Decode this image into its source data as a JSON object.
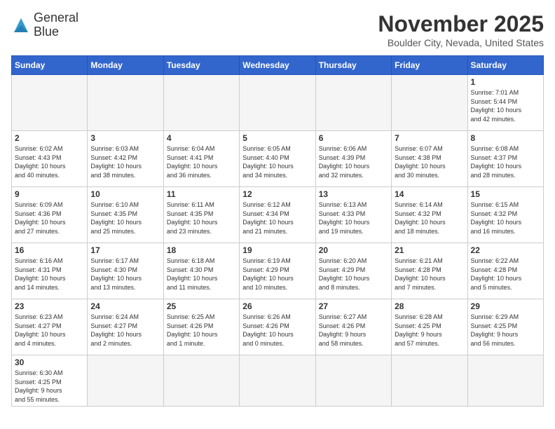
{
  "header": {
    "logo_line1": "General",
    "logo_line2": "Blue",
    "month": "November 2025",
    "location": "Boulder City, Nevada, United States"
  },
  "weekdays": [
    "Sunday",
    "Monday",
    "Tuesday",
    "Wednesday",
    "Thursday",
    "Friday",
    "Saturday"
  ],
  "weeks": [
    [
      {
        "day": "",
        "info": ""
      },
      {
        "day": "",
        "info": ""
      },
      {
        "day": "",
        "info": ""
      },
      {
        "day": "",
        "info": ""
      },
      {
        "day": "",
        "info": ""
      },
      {
        "day": "",
        "info": ""
      },
      {
        "day": "1",
        "info": "Sunrise: 7:01 AM\nSunset: 5:44 PM\nDaylight: 10 hours\nand 42 minutes."
      }
    ],
    [
      {
        "day": "2",
        "info": "Sunrise: 6:02 AM\nSunset: 4:43 PM\nDaylight: 10 hours\nand 40 minutes."
      },
      {
        "day": "3",
        "info": "Sunrise: 6:03 AM\nSunset: 4:42 PM\nDaylight: 10 hours\nand 38 minutes."
      },
      {
        "day": "4",
        "info": "Sunrise: 6:04 AM\nSunset: 4:41 PM\nDaylight: 10 hours\nand 36 minutes."
      },
      {
        "day": "5",
        "info": "Sunrise: 6:05 AM\nSunset: 4:40 PM\nDaylight: 10 hours\nand 34 minutes."
      },
      {
        "day": "6",
        "info": "Sunrise: 6:06 AM\nSunset: 4:39 PM\nDaylight: 10 hours\nand 32 minutes."
      },
      {
        "day": "7",
        "info": "Sunrise: 6:07 AM\nSunset: 4:38 PM\nDaylight: 10 hours\nand 30 minutes."
      },
      {
        "day": "8",
        "info": "Sunrise: 6:08 AM\nSunset: 4:37 PM\nDaylight: 10 hours\nand 28 minutes."
      }
    ],
    [
      {
        "day": "9",
        "info": "Sunrise: 6:09 AM\nSunset: 4:36 PM\nDaylight: 10 hours\nand 27 minutes."
      },
      {
        "day": "10",
        "info": "Sunrise: 6:10 AM\nSunset: 4:35 PM\nDaylight: 10 hours\nand 25 minutes."
      },
      {
        "day": "11",
        "info": "Sunrise: 6:11 AM\nSunset: 4:35 PM\nDaylight: 10 hours\nand 23 minutes."
      },
      {
        "day": "12",
        "info": "Sunrise: 6:12 AM\nSunset: 4:34 PM\nDaylight: 10 hours\nand 21 minutes."
      },
      {
        "day": "13",
        "info": "Sunrise: 6:13 AM\nSunset: 4:33 PM\nDaylight: 10 hours\nand 19 minutes."
      },
      {
        "day": "14",
        "info": "Sunrise: 6:14 AM\nSunset: 4:32 PM\nDaylight: 10 hours\nand 18 minutes."
      },
      {
        "day": "15",
        "info": "Sunrise: 6:15 AM\nSunset: 4:32 PM\nDaylight: 10 hours\nand 16 minutes."
      }
    ],
    [
      {
        "day": "16",
        "info": "Sunrise: 6:16 AM\nSunset: 4:31 PM\nDaylight: 10 hours\nand 14 minutes."
      },
      {
        "day": "17",
        "info": "Sunrise: 6:17 AM\nSunset: 4:30 PM\nDaylight: 10 hours\nand 13 minutes."
      },
      {
        "day": "18",
        "info": "Sunrise: 6:18 AM\nSunset: 4:30 PM\nDaylight: 10 hours\nand 11 minutes."
      },
      {
        "day": "19",
        "info": "Sunrise: 6:19 AM\nSunset: 4:29 PM\nDaylight: 10 hours\nand 10 minutes."
      },
      {
        "day": "20",
        "info": "Sunrise: 6:20 AM\nSunset: 4:29 PM\nDaylight: 10 hours\nand 8 minutes."
      },
      {
        "day": "21",
        "info": "Sunrise: 6:21 AM\nSunset: 4:28 PM\nDaylight: 10 hours\nand 7 minutes."
      },
      {
        "day": "22",
        "info": "Sunrise: 6:22 AM\nSunset: 4:28 PM\nDaylight: 10 hours\nand 5 minutes."
      }
    ],
    [
      {
        "day": "23",
        "info": "Sunrise: 6:23 AM\nSunset: 4:27 PM\nDaylight: 10 hours\nand 4 minutes."
      },
      {
        "day": "24",
        "info": "Sunrise: 6:24 AM\nSunset: 4:27 PM\nDaylight: 10 hours\nand 2 minutes."
      },
      {
        "day": "25",
        "info": "Sunrise: 6:25 AM\nSunset: 4:26 PM\nDaylight: 10 hours\nand 1 minute."
      },
      {
        "day": "26",
        "info": "Sunrise: 6:26 AM\nSunset: 4:26 PM\nDaylight: 10 hours\nand 0 minutes."
      },
      {
        "day": "27",
        "info": "Sunrise: 6:27 AM\nSunset: 4:26 PM\nDaylight: 9 hours\nand 58 minutes."
      },
      {
        "day": "28",
        "info": "Sunrise: 6:28 AM\nSunset: 4:25 PM\nDaylight: 9 hours\nand 57 minutes."
      },
      {
        "day": "29",
        "info": "Sunrise: 6:29 AM\nSunset: 4:25 PM\nDaylight: 9 hours\nand 56 minutes."
      }
    ],
    [
      {
        "day": "30",
        "info": "Sunrise: 6:30 AM\nSunset: 4:25 PM\nDaylight: 9 hours\nand 55 minutes."
      },
      {
        "day": "",
        "info": ""
      },
      {
        "day": "",
        "info": ""
      },
      {
        "day": "",
        "info": ""
      },
      {
        "day": "",
        "info": ""
      },
      {
        "day": "",
        "info": ""
      },
      {
        "day": "",
        "info": ""
      }
    ]
  ]
}
